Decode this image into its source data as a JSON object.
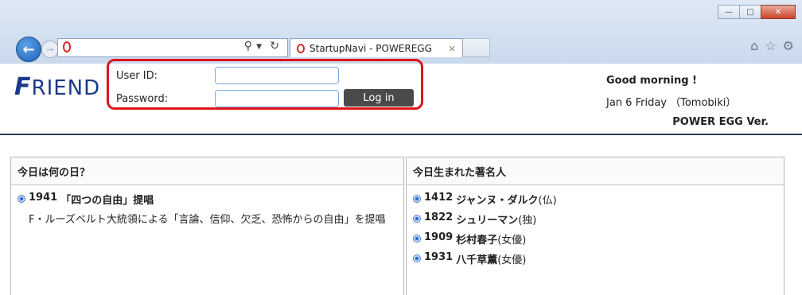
{
  "browser": {
    "tab_title": "StartupNavi - POWEREGG",
    "tab_close": "×",
    "window_buttons": [
      "—",
      "□",
      "✕"
    ],
    "toolbar_icons": [
      "home-icon",
      "star-icon",
      "gear-icon"
    ]
  },
  "header": {
    "logo_f": "F",
    "logo_rest": "RIEND",
    "user_label": "User ID:",
    "password_label": "Password:",
    "user_value": "",
    "password_value": "",
    "login_button": "Log in",
    "greeting": "Good morning !",
    "date": "Jan 6 Friday （Tomobiki）",
    "version": "POWER EGG Ver."
  },
  "left_panel": {
    "title": "今日は何の日？",
    "items": [
      {
        "year": "1941",
        "title": "「四つの自由」提唱",
        "description": "F・ルーズベルト大統領による「言論、信仰、欠乏、恐怖からの自由」を提唱"
      }
    ]
  },
  "right_panel": {
    "title": "今日生まれた著名人",
    "items": [
      {
        "year": "1412",
        "name": "ジャンヌ・ダルク",
        "note": "(仏)"
      },
      {
        "year": "1822",
        "name": "シュリーマン",
        "note": "(独)"
      },
      {
        "year": "1909",
        "name": "杉村春子",
        "note": "(女優)"
      },
      {
        "year": "1931",
        "name": "八千草薫",
        "note": "(女優)"
      }
    ]
  },
  "colors": {
    "accent": "#1a3a8a",
    "highlight": "#e0141b",
    "button": "#4a4a4a"
  }
}
